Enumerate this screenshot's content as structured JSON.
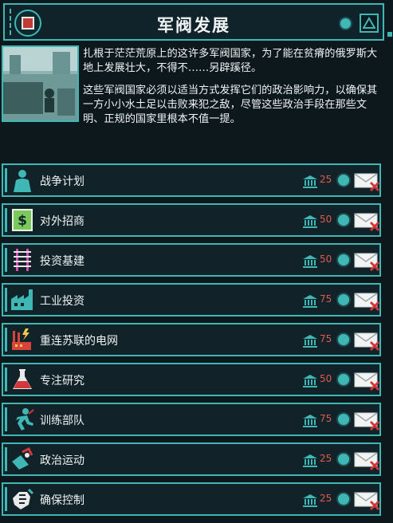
{
  "header": {
    "title": "军阀发展",
    "logo_icon": "soviet-emblem-icon",
    "status_icon": "circle-indicator-icon",
    "collapse_icon": "triangle-collapse-icon"
  },
  "intro": {
    "paragraph1": "扎根于茫茫荒原上的这许多军阀国家，为了能在贫瘠的俄罗斯大地上发展壮大，不得不……另辟蹊径。",
    "paragraph2": "这些军阀国家必须以适当方式发挥它们的政治影响力，以确保其一方小小水土足以击败来犯之敌，尽管这些政治手段在那些文明、正规的国家里根本不值一提。"
  },
  "colors": {
    "accent": "#3fb7b4",
    "cost": "#e05a4d",
    "background": "#0c181c"
  },
  "decisions": [
    {
      "label": "战争计划",
      "cost": "25",
      "icon": "soldier-icon"
    },
    {
      "label": "对外招商",
      "cost": "50",
      "icon": "dollar-bill-icon"
    },
    {
      "label": "投资基建",
      "cost": "50",
      "icon": "rail-track-icon"
    },
    {
      "label": "工业投资",
      "cost": "75",
      "icon": "factory-icon"
    },
    {
      "label": "重连苏联的电网",
      "cost": "75",
      "icon": "power-plant-icon"
    },
    {
      "label": "专注研究",
      "cost": "50",
      "icon": "flask-icon"
    },
    {
      "label": "训练部队",
      "cost": "75",
      "icon": "running-soldier-icon"
    },
    {
      "label": "政治运动",
      "cost": "25",
      "icon": "megaphone-icon"
    },
    {
      "label": "确保控制",
      "cost": "25",
      "icon": "fist-icon"
    }
  ]
}
